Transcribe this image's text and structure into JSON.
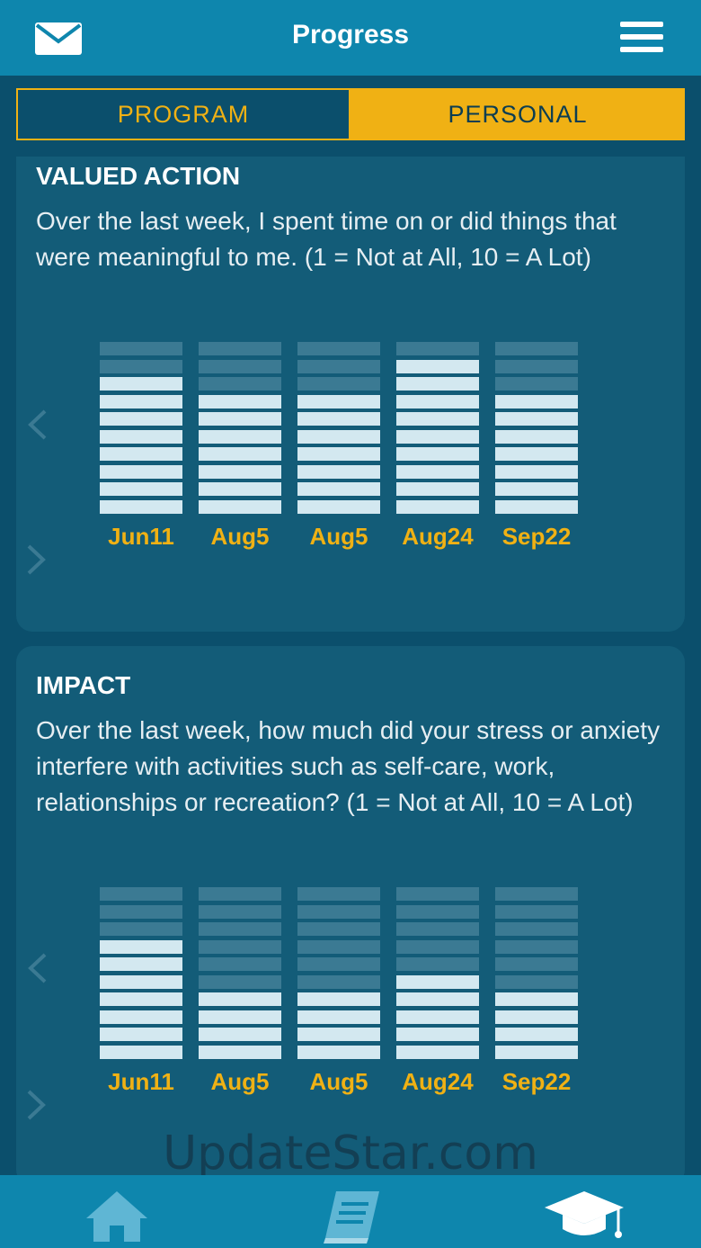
{
  "header": {
    "title": "Progress",
    "left_icon": "mail-icon",
    "right_icon": "menu-icon"
  },
  "tabs": [
    {
      "label": "PROGRAM",
      "selected": false
    },
    {
      "label": "PERSONAL",
      "selected": true
    }
  ],
  "colors": {
    "background": "#0b4f6c",
    "bar": "#0e86ad",
    "card": "#135c78",
    "accent": "#f0b114",
    "segment_on": "#d3e8f0",
    "segment_off": "#3b7a93"
  },
  "cards": [
    {
      "title": "VALUED ACTION",
      "description": "Over the last week, I spent time on or did things that were meaningful to me. (1 = Not at All, 10 = A Lot)",
      "chart_data": {
        "type": "bar",
        "categories": [
          "Jun11",
          "Aug5",
          "Aug5",
          "Aug24",
          "Sep22"
        ],
        "values": [
          8,
          7,
          7,
          9,
          7
        ],
        "ylim": [
          0,
          10
        ]
      }
    },
    {
      "title": "IMPACT",
      "description": "Over the last week, how much did your stress or anxiety interfere with activities such as self-care, work, relationships or recreation? (1 = Not at All, 10 = A Lot)",
      "chart_data": {
        "type": "bar",
        "categories": [
          "Jun11",
          "Aug5",
          "Aug5",
          "Aug24",
          "Sep22"
        ],
        "values": [
          7,
          4,
          4,
          5,
          4
        ],
        "ylim": [
          0,
          10
        ]
      }
    }
  ],
  "watermark": "UpdateStar.com",
  "bottom_nav": [
    {
      "icon": "home-icon"
    },
    {
      "icon": "book-icon"
    },
    {
      "icon": "graduation-cap-icon"
    }
  ]
}
